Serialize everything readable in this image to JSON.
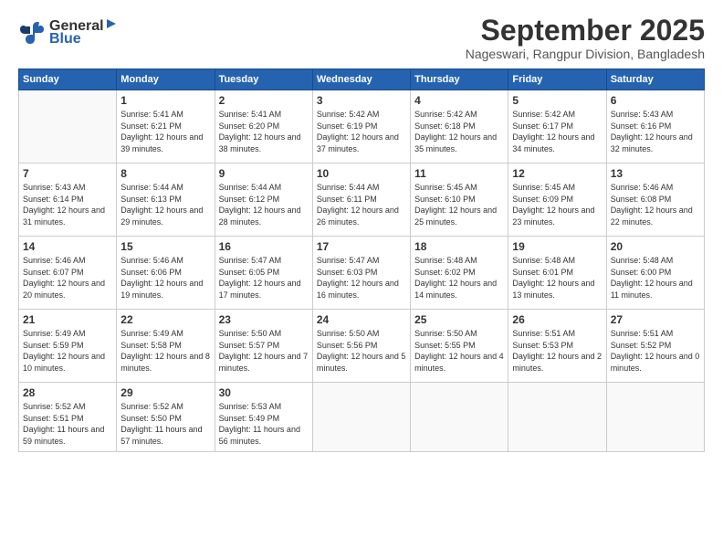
{
  "header": {
    "logo_general": "General",
    "logo_blue": "Blue",
    "month_year": "September 2025",
    "location": "Nageswari, Rangpur Division, Bangladesh"
  },
  "weekdays": [
    "Sunday",
    "Monday",
    "Tuesday",
    "Wednesday",
    "Thursday",
    "Friday",
    "Saturday"
  ],
  "weeks": [
    [
      {
        "day": "",
        "sunrise": "",
        "sunset": "",
        "daylight": ""
      },
      {
        "day": "1",
        "sunrise": "Sunrise: 5:41 AM",
        "sunset": "Sunset: 6:21 PM",
        "daylight": "Daylight: 12 hours and 39 minutes."
      },
      {
        "day": "2",
        "sunrise": "Sunrise: 5:41 AM",
        "sunset": "Sunset: 6:20 PM",
        "daylight": "Daylight: 12 hours and 38 minutes."
      },
      {
        "day": "3",
        "sunrise": "Sunrise: 5:42 AM",
        "sunset": "Sunset: 6:19 PM",
        "daylight": "Daylight: 12 hours and 37 minutes."
      },
      {
        "day": "4",
        "sunrise": "Sunrise: 5:42 AM",
        "sunset": "Sunset: 6:18 PM",
        "daylight": "Daylight: 12 hours and 35 minutes."
      },
      {
        "day": "5",
        "sunrise": "Sunrise: 5:42 AM",
        "sunset": "Sunset: 6:17 PM",
        "daylight": "Daylight: 12 hours and 34 minutes."
      },
      {
        "day": "6",
        "sunrise": "Sunrise: 5:43 AM",
        "sunset": "Sunset: 6:16 PM",
        "daylight": "Daylight: 12 hours and 32 minutes."
      }
    ],
    [
      {
        "day": "7",
        "sunrise": "Sunrise: 5:43 AM",
        "sunset": "Sunset: 6:14 PM",
        "daylight": "Daylight: 12 hours and 31 minutes."
      },
      {
        "day": "8",
        "sunrise": "Sunrise: 5:44 AM",
        "sunset": "Sunset: 6:13 PM",
        "daylight": "Daylight: 12 hours and 29 minutes."
      },
      {
        "day": "9",
        "sunrise": "Sunrise: 5:44 AM",
        "sunset": "Sunset: 6:12 PM",
        "daylight": "Daylight: 12 hours and 28 minutes."
      },
      {
        "day": "10",
        "sunrise": "Sunrise: 5:44 AM",
        "sunset": "Sunset: 6:11 PM",
        "daylight": "Daylight: 12 hours and 26 minutes."
      },
      {
        "day": "11",
        "sunrise": "Sunrise: 5:45 AM",
        "sunset": "Sunset: 6:10 PM",
        "daylight": "Daylight: 12 hours and 25 minutes."
      },
      {
        "day": "12",
        "sunrise": "Sunrise: 5:45 AM",
        "sunset": "Sunset: 6:09 PM",
        "daylight": "Daylight: 12 hours and 23 minutes."
      },
      {
        "day": "13",
        "sunrise": "Sunrise: 5:46 AM",
        "sunset": "Sunset: 6:08 PM",
        "daylight": "Daylight: 12 hours and 22 minutes."
      }
    ],
    [
      {
        "day": "14",
        "sunrise": "Sunrise: 5:46 AM",
        "sunset": "Sunset: 6:07 PM",
        "daylight": "Daylight: 12 hours and 20 minutes."
      },
      {
        "day": "15",
        "sunrise": "Sunrise: 5:46 AM",
        "sunset": "Sunset: 6:06 PM",
        "daylight": "Daylight: 12 hours and 19 minutes."
      },
      {
        "day": "16",
        "sunrise": "Sunrise: 5:47 AM",
        "sunset": "Sunset: 6:05 PM",
        "daylight": "Daylight: 12 hours and 17 minutes."
      },
      {
        "day": "17",
        "sunrise": "Sunrise: 5:47 AM",
        "sunset": "Sunset: 6:03 PM",
        "daylight": "Daylight: 12 hours and 16 minutes."
      },
      {
        "day": "18",
        "sunrise": "Sunrise: 5:48 AM",
        "sunset": "Sunset: 6:02 PM",
        "daylight": "Daylight: 12 hours and 14 minutes."
      },
      {
        "day": "19",
        "sunrise": "Sunrise: 5:48 AM",
        "sunset": "Sunset: 6:01 PM",
        "daylight": "Daylight: 12 hours and 13 minutes."
      },
      {
        "day": "20",
        "sunrise": "Sunrise: 5:48 AM",
        "sunset": "Sunset: 6:00 PM",
        "daylight": "Daylight: 12 hours and 11 minutes."
      }
    ],
    [
      {
        "day": "21",
        "sunrise": "Sunrise: 5:49 AM",
        "sunset": "Sunset: 5:59 PM",
        "daylight": "Daylight: 12 hours and 10 minutes."
      },
      {
        "day": "22",
        "sunrise": "Sunrise: 5:49 AM",
        "sunset": "Sunset: 5:58 PM",
        "daylight": "Daylight: 12 hours and 8 minutes."
      },
      {
        "day": "23",
        "sunrise": "Sunrise: 5:50 AM",
        "sunset": "Sunset: 5:57 PM",
        "daylight": "Daylight: 12 hours and 7 minutes."
      },
      {
        "day": "24",
        "sunrise": "Sunrise: 5:50 AM",
        "sunset": "Sunset: 5:56 PM",
        "daylight": "Daylight: 12 hours and 5 minutes."
      },
      {
        "day": "25",
        "sunrise": "Sunrise: 5:50 AM",
        "sunset": "Sunset: 5:55 PM",
        "daylight": "Daylight: 12 hours and 4 minutes."
      },
      {
        "day": "26",
        "sunrise": "Sunrise: 5:51 AM",
        "sunset": "Sunset: 5:53 PM",
        "daylight": "Daylight: 12 hours and 2 minutes."
      },
      {
        "day": "27",
        "sunrise": "Sunrise: 5:51 AM",
        "sunset": "Sunset: 5:52 PM",
        "daylight": "Daylight: 12 hours and 0 minutes."
      }
    ],
    [
      {
        "day": "28",
        "sunrise": "Sunrise: 5:52 AM",
        "sunset": "Sunset: 5:51 PM",
        "daylight": "Daylight: 11 hours and 59 minutes."
      },
      {
        "day": "29",
        "sunrise": "Sunrise: 5:52 AM",
        "sunset": "Sunset: 5:50 PM",
        "daylight": "Daylight: 11 hours and 57 minutes."
      },
      {
        "day": "30",
        "sunrise": "Sunrise: 5:53 AM",
        "sunset": "Sunset: 5:49 PM",
        "daylight": "Daylight: 11 hours and 56 minutes."
      },
      {
        "day": "",
        "sunrise": "",
        "sunset": "",
        "daylight": ""
      },
      {
        "day": "",
        "sunrise": "",
        "sunset": "",
        "daylight": ""
      },
      {
        "day": "",
        "sunrise": "",
        "sunset": "",
        "daylight": ""
      },
      {
        "day": "",
        "sunrise": "",
        "sunset": "",
        "daylight": ""
      }
    ]
  ]
}
